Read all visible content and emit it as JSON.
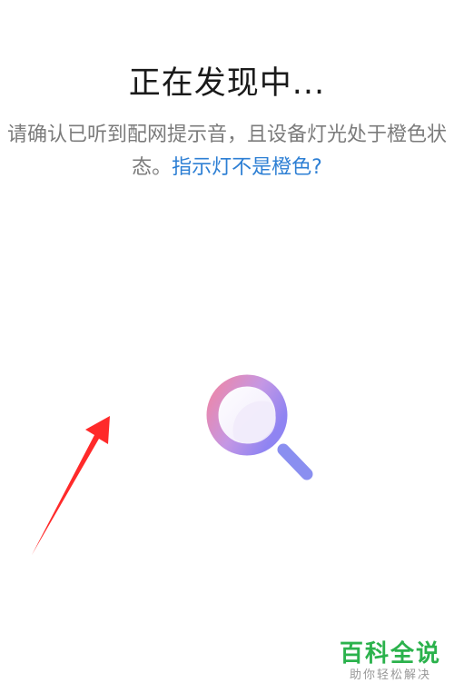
{
  "title": "正在发现中...",
  "description": {
    "text": "请确认已听到配网提示音，且设备灯光处于橙色状态。",
    "link": "指示灯不是橙色?"
  },
  "icons": {
    "search": "search-icon",
    "annotation": "red-arrow-annotation"
  },
  "watermark": {
    "title": "百科全说",
    "subtitle": "助你轻松解决"
  },
  "colors": {
    "link": "#2d7fd4",
    "arrow": "#ff2a2a",
    "watermark": "#2bb24c"
  }
}
